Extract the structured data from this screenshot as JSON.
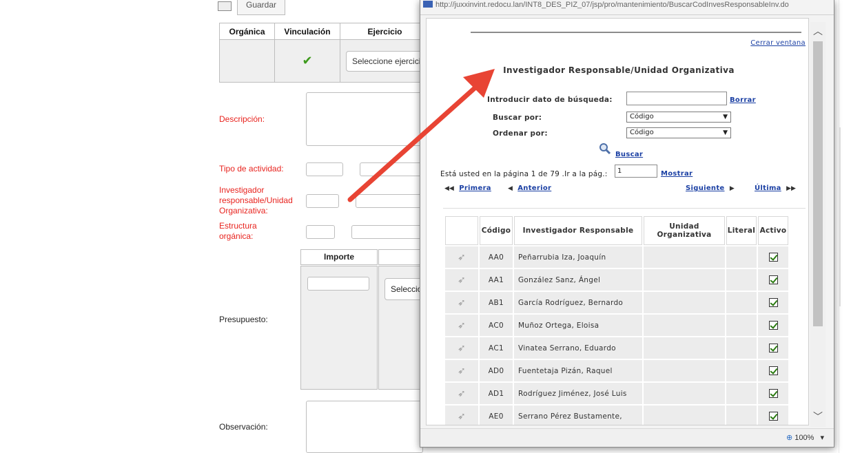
{
  "popup": {
    "address": "http://juxxinvint.redocu.lan/INT8_DES_PIZ_07/jsp/pro/mantenimiento/BuscarCodInvesResponsableInv.do",
    "close_link": "Cerrar ventana",
    "title": "Investigador Responsable/Unidad Organizativa",
    "search_label": "Introducir dato de búsqueda:",
    "search_value": "",
    "clear_link": "Borrar",
    "search_by_label": "Buscar por:",
    "search_by_value": "Código",
    "order_by_label": "Ordenar por:",
    "order_by_value": "Código",
    "search_link": "Buscar",
    "page_info": "Está usted en la página 1 de 79 .Ir a la pág.:",
    "page_input": "1",
    "show_link": "Mostrar",
    "nav": {
      "first": "Primera",
      "prev": "Anterior",
      "next": "Siguiente",
      "last": "Última"
    },
    "columns": [
      "",
      "Código",
      "Investigador Responsable",
      "Unidad Organizativa",
      "Literal",
      "Activo"
    ],
    "rows": [
      {
        "code": "AA0",
        "name": "Peñarrubia Iza, Joaquín"
      },
      {
        "code": "AA1",
        "name": "González Sanz, Ángel"
      },
      {
        "code": "AB1",
        "name": "García Rodríguez, Bernardo"
      },
      {
        "code": "AC0",
        "name": "Muñoz Ortega, Eloisa"
      },
      {
        "code": "AC1",
        "name": "Vinatea Serrano, Eduardo"
      },
      {
        "code": "AD0",
        "name": "Fuentetaja Pizán, Raquel"
      },
      {
        "code": "AD1",
        "name": "Rodríguez Jiménez, José Luis"
      },
      {
        "code": "AE0",
        "name": "Serrano Pérez Bustamente,"
      }
    ],
    "zoom": "100%",
    "zoom_caret": "▾"
  },
  "form": {
    "top_button": "Guardar",
    "columns": {
      "organica": "Orgánica",
      "vinculacion": "Vinculación",
      "ejercicio": "Ejercicio"
    },
    "ejercicio_placeholder": "Seleccione ejercicio",
    "labels": {
      "descripcion": "Descripción:",
      "tipo": "Tipo de actividad:",
      "inv1": "Investigador",
      "inv2": "responsable/Unidad",
      "inv3": "Organizativa:",
      "est1": "Estructura",
      "est2": "orgánica:",
      "presupuesto": "Presupuesto:",
      "observacion": "Observación:"
    },
    "importe_header": "Importe",
    "presupuesto_select": "Seleccione"
  },
  "colors": {
    "required_label": "#e8231e",
    "link": "#1a3fa3",
    "arrow": "#e84434"
  }
}
